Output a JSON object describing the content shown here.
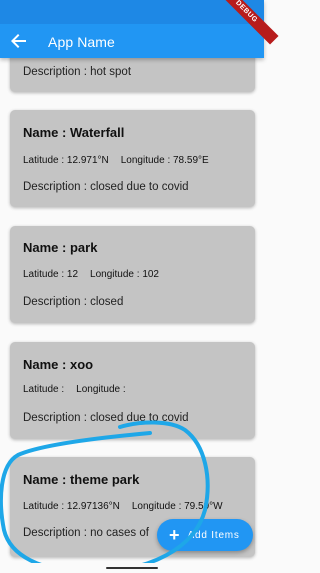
{
  "appbar": {
    "title": "App Name",
    "debug_label": "DEBUG"
  },
  "cards": [
    {
      "description": "Description : hot spot"
    },
    {
      "name": "Name : Waterfall",
      "latitude": "Latitude : 12.971°N",
      "longitude": "Longitude : 78.59°E",
      "description": "Description : closed due to covid"
    },
    {
      "name": "Name : park",
      "latitude": "Latitude : 12",
      "longitude": "Longitude : 102",
      "description": "Description : closed"
    },
    {
      "name": "Name : xoo",
      "latitude": "Latitude :",
      "longitude": "Longitude :",
      "description": "Description : closed due to covid"
    },
    {
      "name": "Name : theme park",
      "latitude": "Latitude : 12.97136°N",
      "longitude": "Longitude : 79.59°W",
      "description": "Description : no cases of"
    }
  ],
  "fab": {
    "label": "Add Items"
  },
  "colors": {
    "primary": "#2196f3",
    "card": "#c4c4c4",
    "scribble": "#1ea7e8"
  }
}
